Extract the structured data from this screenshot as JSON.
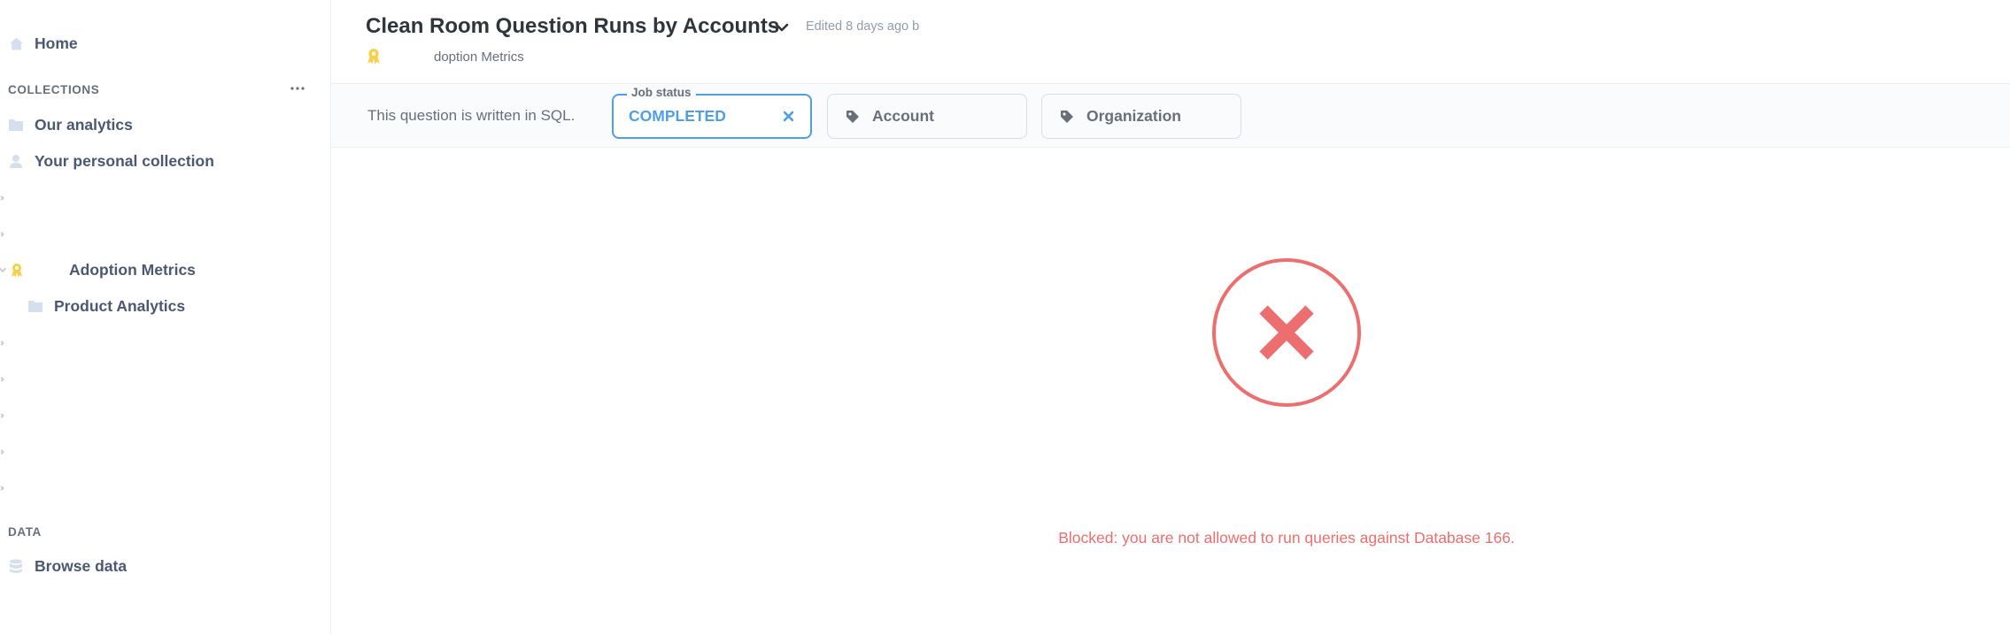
{
  "sidebar": {
    "home_label": "Home",
    "collections_title": "COLLECTIONS",
    "collections": [
      {
        "label": "Our analytics",
        "icon": "folder-icon"
      },
      {
        "label": "Your personal collection",
        "icon": "person-icon"
      }
    ],
    "official_collection": {
      "label": "Adoption Metrics",
      "icon": "official-badge-icon"
    },
    "sub_collection": {
      "label": "Product Analytics",
      "icon": "folder-icon"
    },
    "data_title": "DATA",
    "browse_label": "Browse data"
  },
  "header": {
    "title": "Clean Room Question Runs by Accounts",
    "edited": "Edited 8 days ago b",
    "breadcrumb": "doption Metrics"
  },
  "filters": {
    "sql_note": "This question is written in SQL.",
    "job_status": {
      "legend": "Job status",
      "value": "COMPLETED"
    },
    "account": {
      "label": "Account"
    },
    "organization": {
      "label": "Organization"
    }
  },
  "error": {
    "message": "Blocked: you are not allowed to run queries against Database 166."
  },
  "colors": {
    "brand": "#509ee3",
    "error": "#ed6e6e",
    "official": "#f9cf48",
    "text_dark": "#2e353b",
    "text_medium": "#4c5773"
  }
}
